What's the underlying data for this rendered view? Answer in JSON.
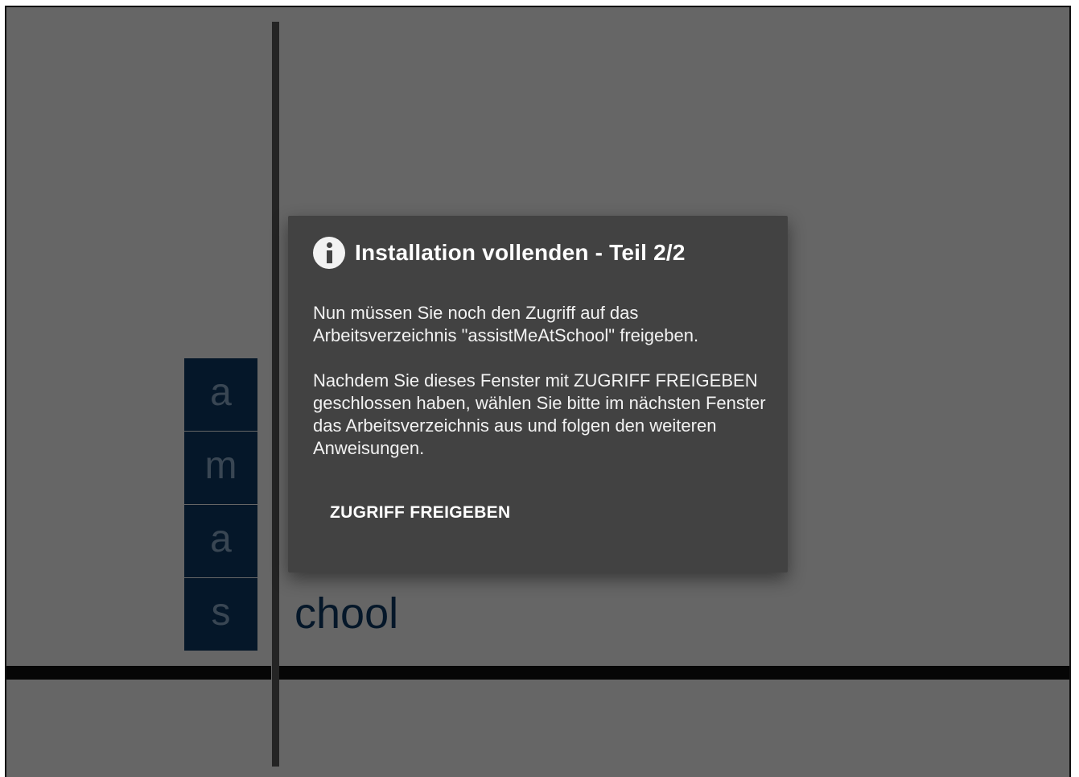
{
  "splash": {
    "letters": [
      "a",
      "m",
      "a",
      "s"
    ],
    "word_suffix": "chool",
    "brand_color": "#0d3a66"
  },
  "dialog": {
    "icon": "info-icon",
    "title": "Installation vollenden - Teil 2/2",
    "paragraph_1": "Nun müssen Sie noch den Zugriff auf das Arbeitsverzeichnis \"assistMeAtSchool\" freigeben.",
    "paragraph_2": "Nachdem Sie dieses Fenster mit ZUGRIFF FREIGEBEN geschlossen haben, wählen Sie bitte im nächsten Fenster das Arbeitsverzeichnis aus und folgen den weiteren Anweisungen.",
    "action_label": "ZUGRIFF FREIGEBEN",
    "background_color": "#424242"
  }
}
